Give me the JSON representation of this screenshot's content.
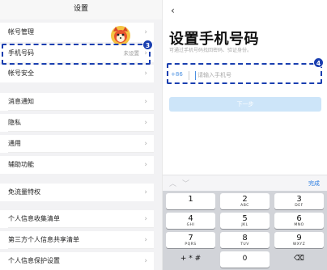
{
  "left": {
    "header_title": "设置",
    "rows": [
      {
        "label": "帐号管理"
      },
      {
        "label": "手机号码",
        "value": "未设置"
      },
      {
        "label": "帐号安全"
      },
      {
        "label": "消息通知"
      },
      {
        "label": "隐私"
      },
      {
        "label": "通用"
      },
      {
        "label": "辅助功能"
      },
      {
        "label": "免流量特权"
      },
      {
        "label": "个人信息收集清单"
      },
      {
        "label": "第三方个人信息共享清单"
      },
      {
        "label": "个人信息保护设置"
      }
    ],
    "badge": "3",
    "chevron": "›"
  },
  "right": {
    "back": "‹",
    "title": "设置手机号码",
    "subtitle": "可通过手机号码找回密码、验证身份。",
    "country_code": "+86",
    "phone_placeholder": "请输入手机号",
    "next_label": "下一步",
    "badge": "4",
    "keyboard": {
      "done": "完成",
      "keys": [
        {
          "num": "1",
          "letters": ""
        },
        {
          "num": "2",
          "letters": "ABC"
        },
        {
          "num": "3",
          "letters": "DEF"
        },
        {
          "num": "4",
          "letters": "GHI"
        },
        {
          "num": "5",
          "letters": "JKL"
        },
        {
          "num": "6",
          "letters": "MNO"
        },
        {
          "num": "7",
          "letters": "PQRS"
        },
        {
          "num": "8",
          "letters": "TUV"
        },
        {
          "num": "9",
          "letters": "WXYZ"
        },
        {
          "num": "+ * #",
          "letters": ""
        },
        {
          "num": "0",
          "letters": ""
        },
        {
          "num": "⌫",
          "letters": ""
        }
      ]
    }
  },
  "colors": {
    "accent": "#1a3fb0",
    "link_blue": "#4a90e2",
    "button_disabled": "#cde5f9"
  }
}
